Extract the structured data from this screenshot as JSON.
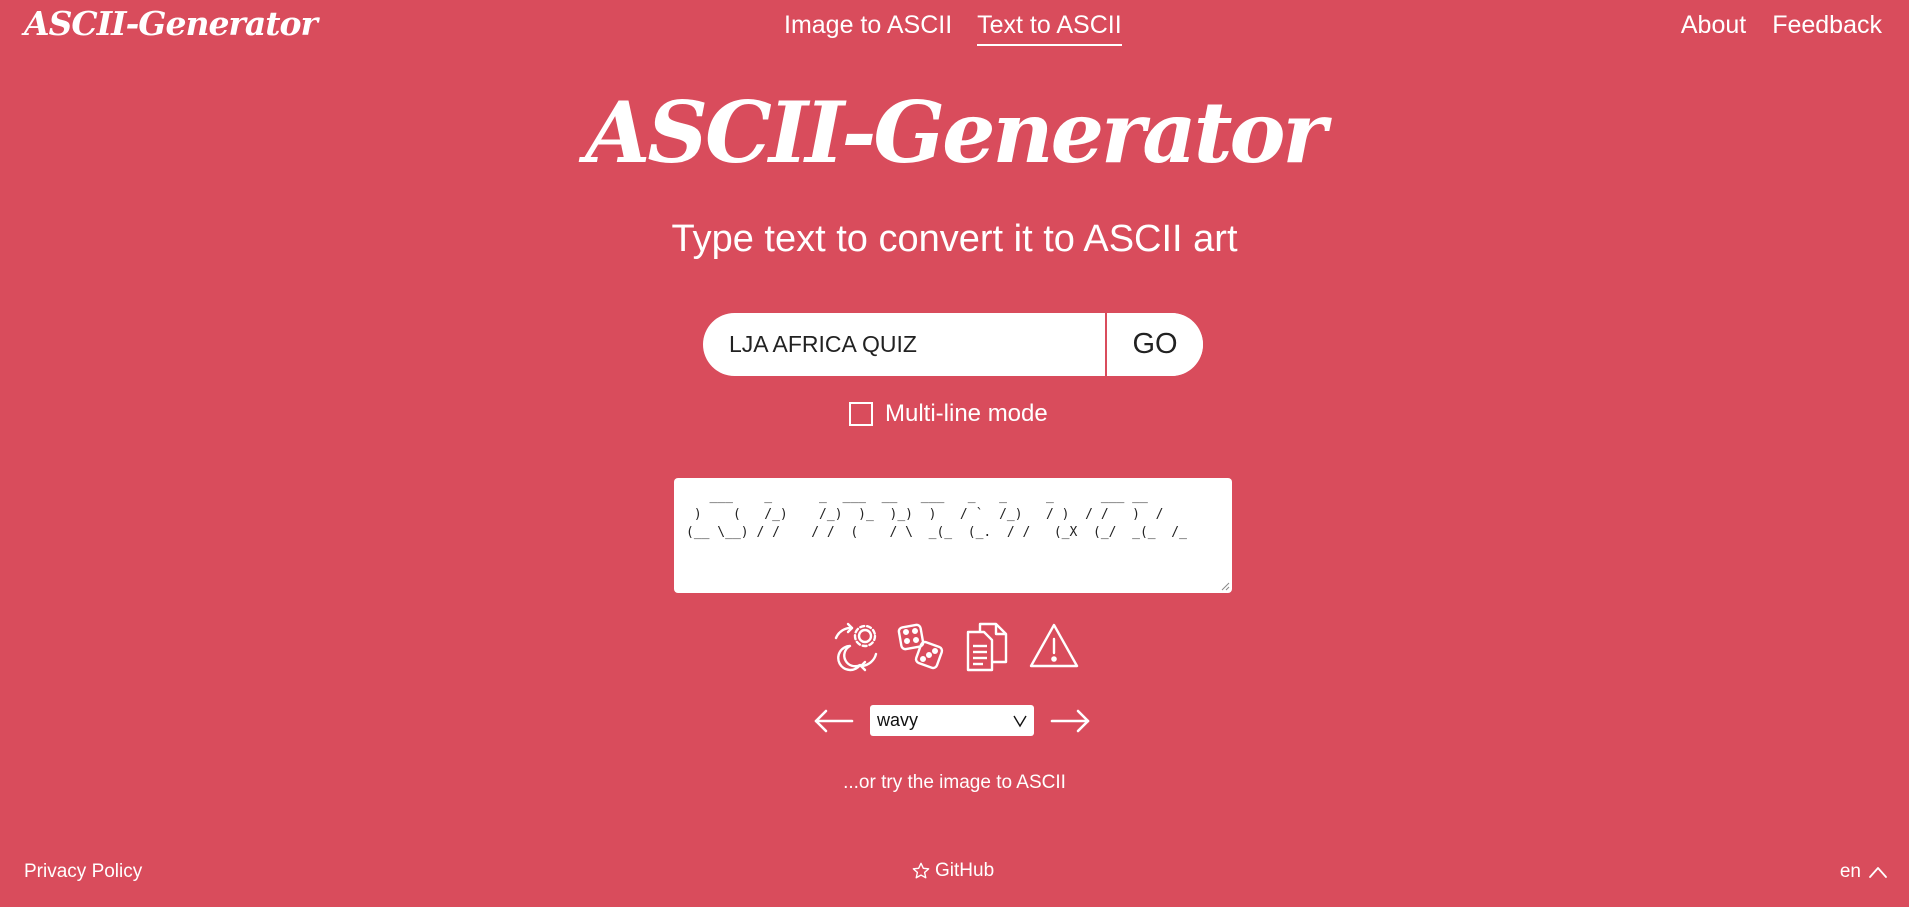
{
  "header": {
    "brand": "ASCII-Generator",
    "nav": [
      {
        "label": "Image to ASCII",
        "active": false
      },
      {
        "label": "Text to ASCII",
        "active": true
      }
    ],
    "right_links": [
      {
        "label": "About"
      },
      {
        "label": "Feedback"
      }
    ]
  },
  "hero": {
    "title": "ASCII-Generator",
    "subtitle": "Type text to convert it to ASCII art"
  },
  "input": {
    "value": "LJA AFRICA QUIZ",
    "go_label": "GO",
    "multiline_label": "Multi-line mode",
    "multiline_checked": false
  },
  "output": {
    "ascii": "   ___    _      _  ___  __   ___   _   _     _      ___ __\n )    (   /_)    /_)  )_  )_)  )   / `  /_)   / )  / /   )  /\n(__ \\__) / /    / /  (    / \\  _(_  (_.  / /   (_X  (_/  _(_  /_"
  },
  "tools": [
    {
      "icon": "theme-toggle-icon"
    },
    {
      "icon": "dice-icon"
    },
    {
      "icon": "copy-icon"
    },
    {
      "icon": "warning-icon"
    }
  ],
  "font_selector": {
    "value": "wavy"
  },
  "alt_link": "...or try the image to ASCII",
  "footer": {
    "privacy": "Privacy Policy",
    "github": "GitHub",
    "lang": "en"
  },
  "colors": {
    "background": "#d94c5c",
    "text": "#ffffff"
  }
}
